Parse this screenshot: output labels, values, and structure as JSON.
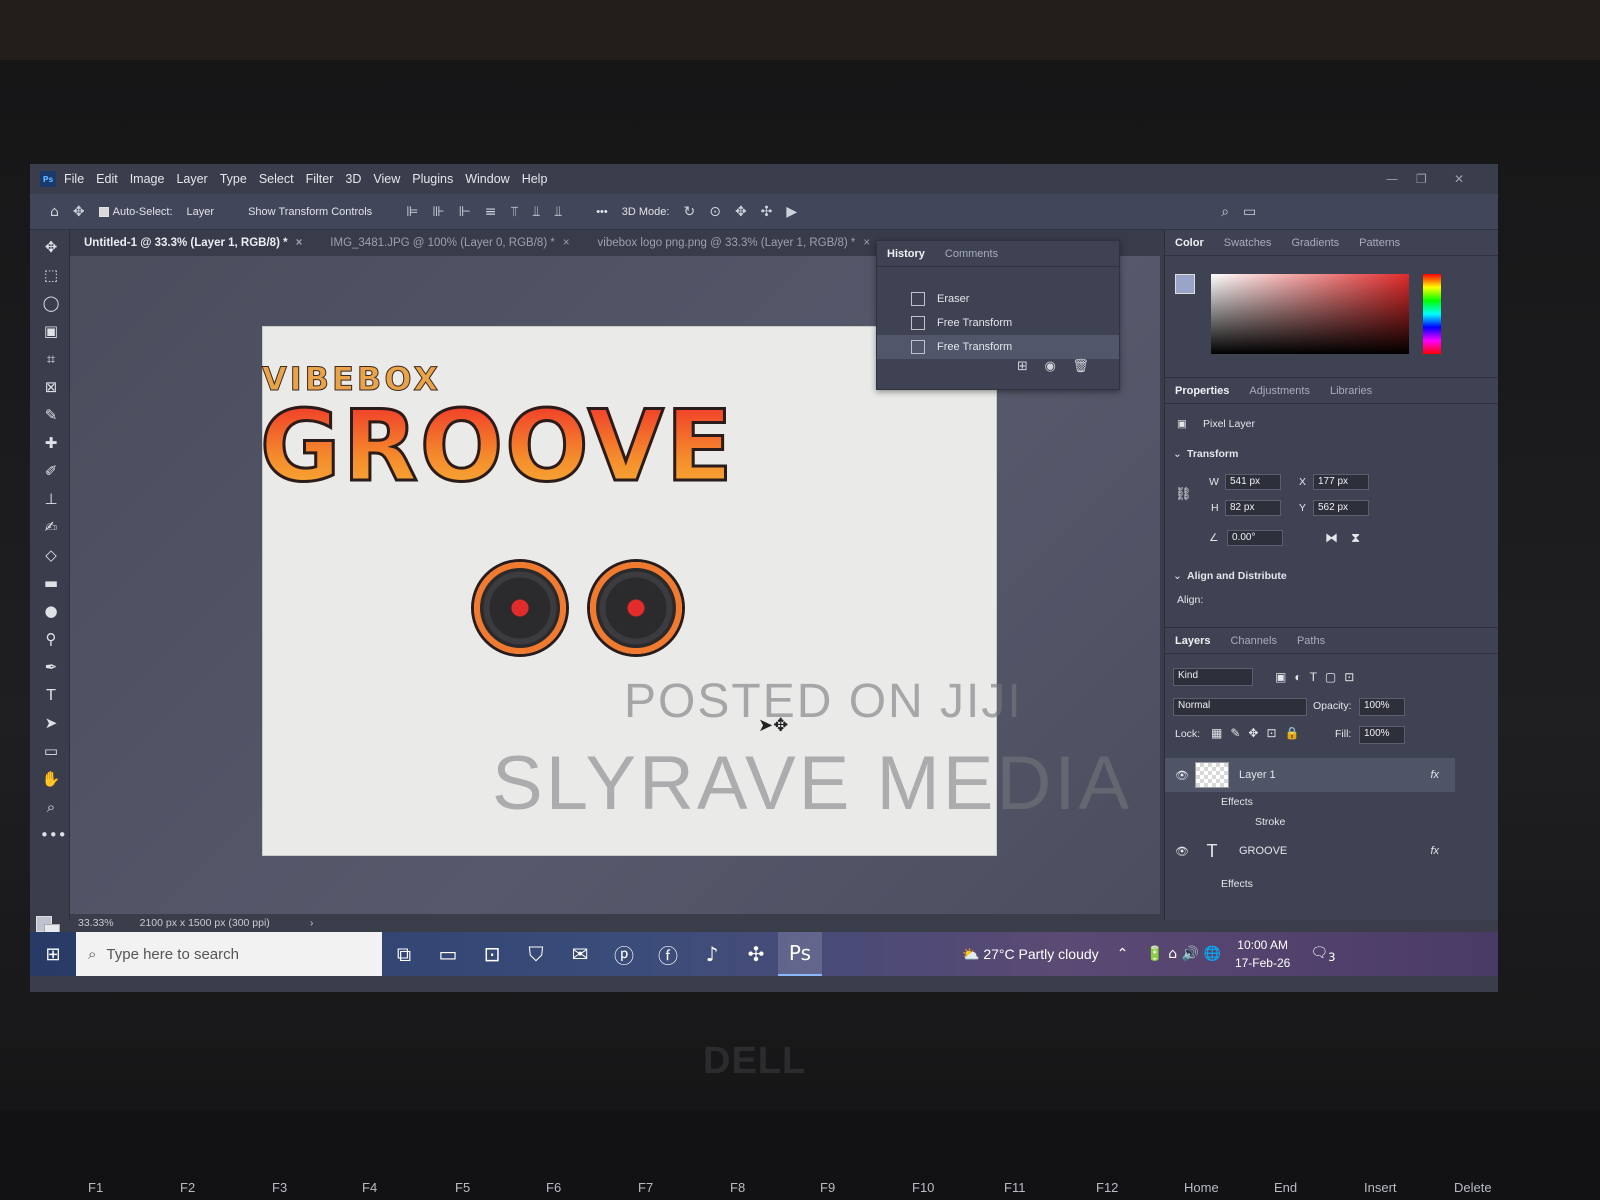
{
  "app": {
    "icon_text": "Ps"
  },
  "menu": [
    "File",
    "Edit",
    "Image",
    "Layer",
    "Type",
    "Select",
    "Filter",
    "3D",
    "View",
    "Plugins",
    "Window",
    "Help"
  ],
  "options": {
    "auto_select": "Auto-Select:",
    "auto_select_target": "Layer",
    "show_transform": "Show Transform Controls",
    "mode_3d": "3D Mode:",
    "more": "•••"
  },
  "tabs": [
    {
      "label": "Untitled-1 @ 33.3% (Layer 1, RGB/8) *",
      "active": true
    },
    {
      "label": "IMG_3481.JPG @ 100% (Layer 0, RGB/8) *",
      "active": false
    },
    {
      "label": "vibebox logo png.png @ 33.3% (Layer 1, RGB/8) *",
      "active": false
    }
  ],
  "artwork": {
    "brand_small": "VIBEBOX",
    "brand_large": "GROOVE",
    "watermark_1": "POSTED ON JIJI",
    "watermark_2": "SLYRAVE MEDIA"
  },
  "status": {
    "zoom": "33.33%",
    "doc_info": "2100 px x 1500 px (300 ppi)"
  },
  "history": {
    "tabs": [
      "History",
      "Comments"
    ],
    "items": [
      "Eraser",
      "Free Transform",
      "Free Transform"
    ]
  },
  "color_panel": {
    "tabs": [
      "Color",
      "Swatches",
      "Gradients",
      "Patterns"
    ]
  },
  "properties": {
    "tabs": [
      "Properties",
      "Adjustments",
      "Libraries"
    ],
    "layer_kind": "Pixel Layer",
    "transform_title": "Transform",
    "w_label": "W",
    "w": "541 px",
    "h_label": "H",
    "h": "82 px",
    "x_label": "X",
    "x": "177 px",
    "y_label": "Y",
    "y": "562 px",
    "angle": "0.00°",
    "align_title": "Align and Distribute",
    "align_label": "Align:"
  },
  "layers": {
    "tabs": [
      "Layers",
      "Channels",
      "Paths"
    ],
    "kind": "Kind",
    "blend": "Normal",
    "opacity_label": "Opacity:",
    "opacity": "100%",
    "lock_label": "Lock:",
    "fill_label": "Fill:",
    "fill": "100%",
    "items": [
      {
        "name": "Layer 1",
        "effects": "Effects",
        "effect": "Stroke"
      },
      {
        "name": "GROOVE",
        "effects": "Effects"
      }
    ]
  },
  "taskbar": {
    "search_placeholder": "Type here to search",
    "weather": "27°C  Partly cloudy",
    "time": "10:00 AM",
    "date": "17-Feb-26",
    "notification_count": "3"
  },
  "keyboard": [
    "F1",
    "F2",
    "F3",
    "F4",
    "F5",
    "F6",
    "F7",
    "F8",
    "F9",
    "F10",
    "F11",
    "F12",
    "Home",
    "End",
    "Insert",
    "Delete"
  ],
  "laptop_brand": "DELL"
}
